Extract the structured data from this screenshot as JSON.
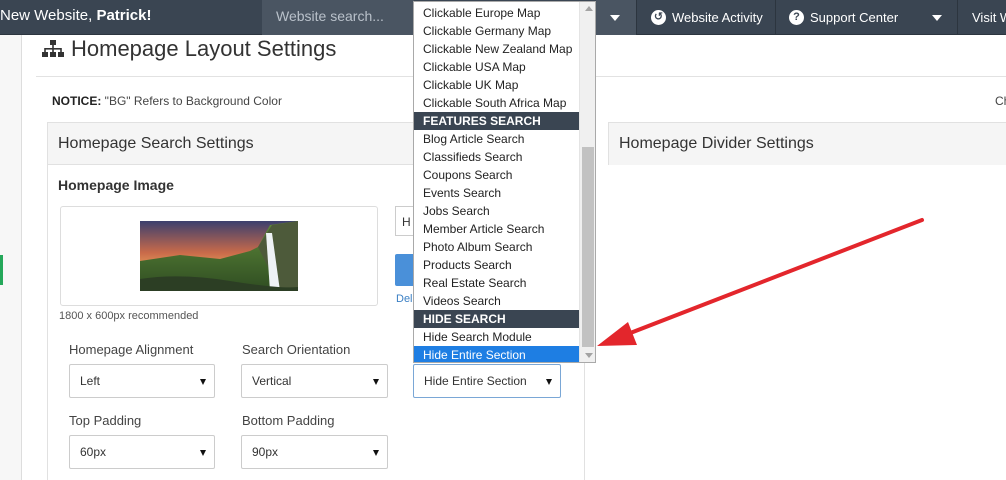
{
  "topbar": {
    "welcome_prefix": "New Website,",
    "welcome_name": "Patrick!",
    "search_placeholder": "Website search...",
    "nav": [
      {
        "icon": "history-icon",
        "label": "Website Activity"
      },
      {
        "icon": "help-icon",
        "label": "Support Center"
      },
      {
        "label": "Visit W"
      }
    ]
  },
  "page": {
    "title": "Homepage Layout Settings",
    "title_icon": "sitemap-icon",
    "notice_label": "NOTICE:",
    "notice_text": " \"BG\" Refers to Background Color",
    "right_cut": "Ch"
  },
  "search_panel": {
    "title": "Homepage Search Settings",
    "image_label": "Homepage Image",
    "image_recommend": "1800 x 600px recommended",
    "hidden_input_text": "H",
    "delete_link": "Del",
    "alignment_label": "Homepage Alignment",
    "alignment_value": "Left",
    "orientation_label": "Search Orientation",
    "orientation_value": "Vertical",
    "module_value": "Hide Entire Section",
    "top_padding_label": "Top Padding",
    "top_padding_value": "60px",
    "bottom_padding_label": "Bottom Padding",
    "bottom_padding_value": "90px"
  },
  "divider_panel": {
    "title": "Homepage Divider Settings"
  },
  "dropdown": {
    "items": [
      {
        "label": "Clickable Europe Map",
        "type": "option"
      },
      {
        "label": "Clickable Germany Map",
        "type": "option"
      },
      {
        "label": "Clickable New Zealand Map",
        "type": "option"
      },
      {
        "label": "Clickable USA Map",
        "type": "option"
      },
      {
        "label": "Clickable UK Map",
        "type": "option"
      },
      {
        "label": "Clickable South Africa Map",
        "type": "option"
      },
      {
        "label": "FEATURES SEARCH",
        "type": "group"
      },
      {
        "label": "Blog Article Search",
        "type": "option"
      },
      {
        "label": "Classifieds Search",
        "type": "option"
      },
      {
        "label": "Coupons Search",
        "type": "option"
      },
      {
        "label": "Events Search",
        "type": "option"
      },
      {
        "label": "Jobs Search",
        "type": "option"
      },
      {
        "label": "Member Article Search",
        "type": "option"
      },
      {
        "label": "Photo Album Search",
        "type": "option"
      },
      {
        "label": "Products Search",
        "type": "option"
      },
      {
        "label": "Real Estate Search",
        "type": "option"
      },
      {
        "label": "Videos Search",
        "type": "option"
      },
      {
        "label": "HIDE SEARCH",
        "type": "group"
      },
      {
        "label": "Hide Search Module",
        "type": "option"
      },
      {
        "label": "Hide Entire Section",
        "type": "selected"
      }
    ]
  },
  "colors": {
    "topbar": "#3a4552",
    "selection": "#1e7ee3",
    "arrow": "#e3262c",
    "link": "#3a7fc4"
  }
}
